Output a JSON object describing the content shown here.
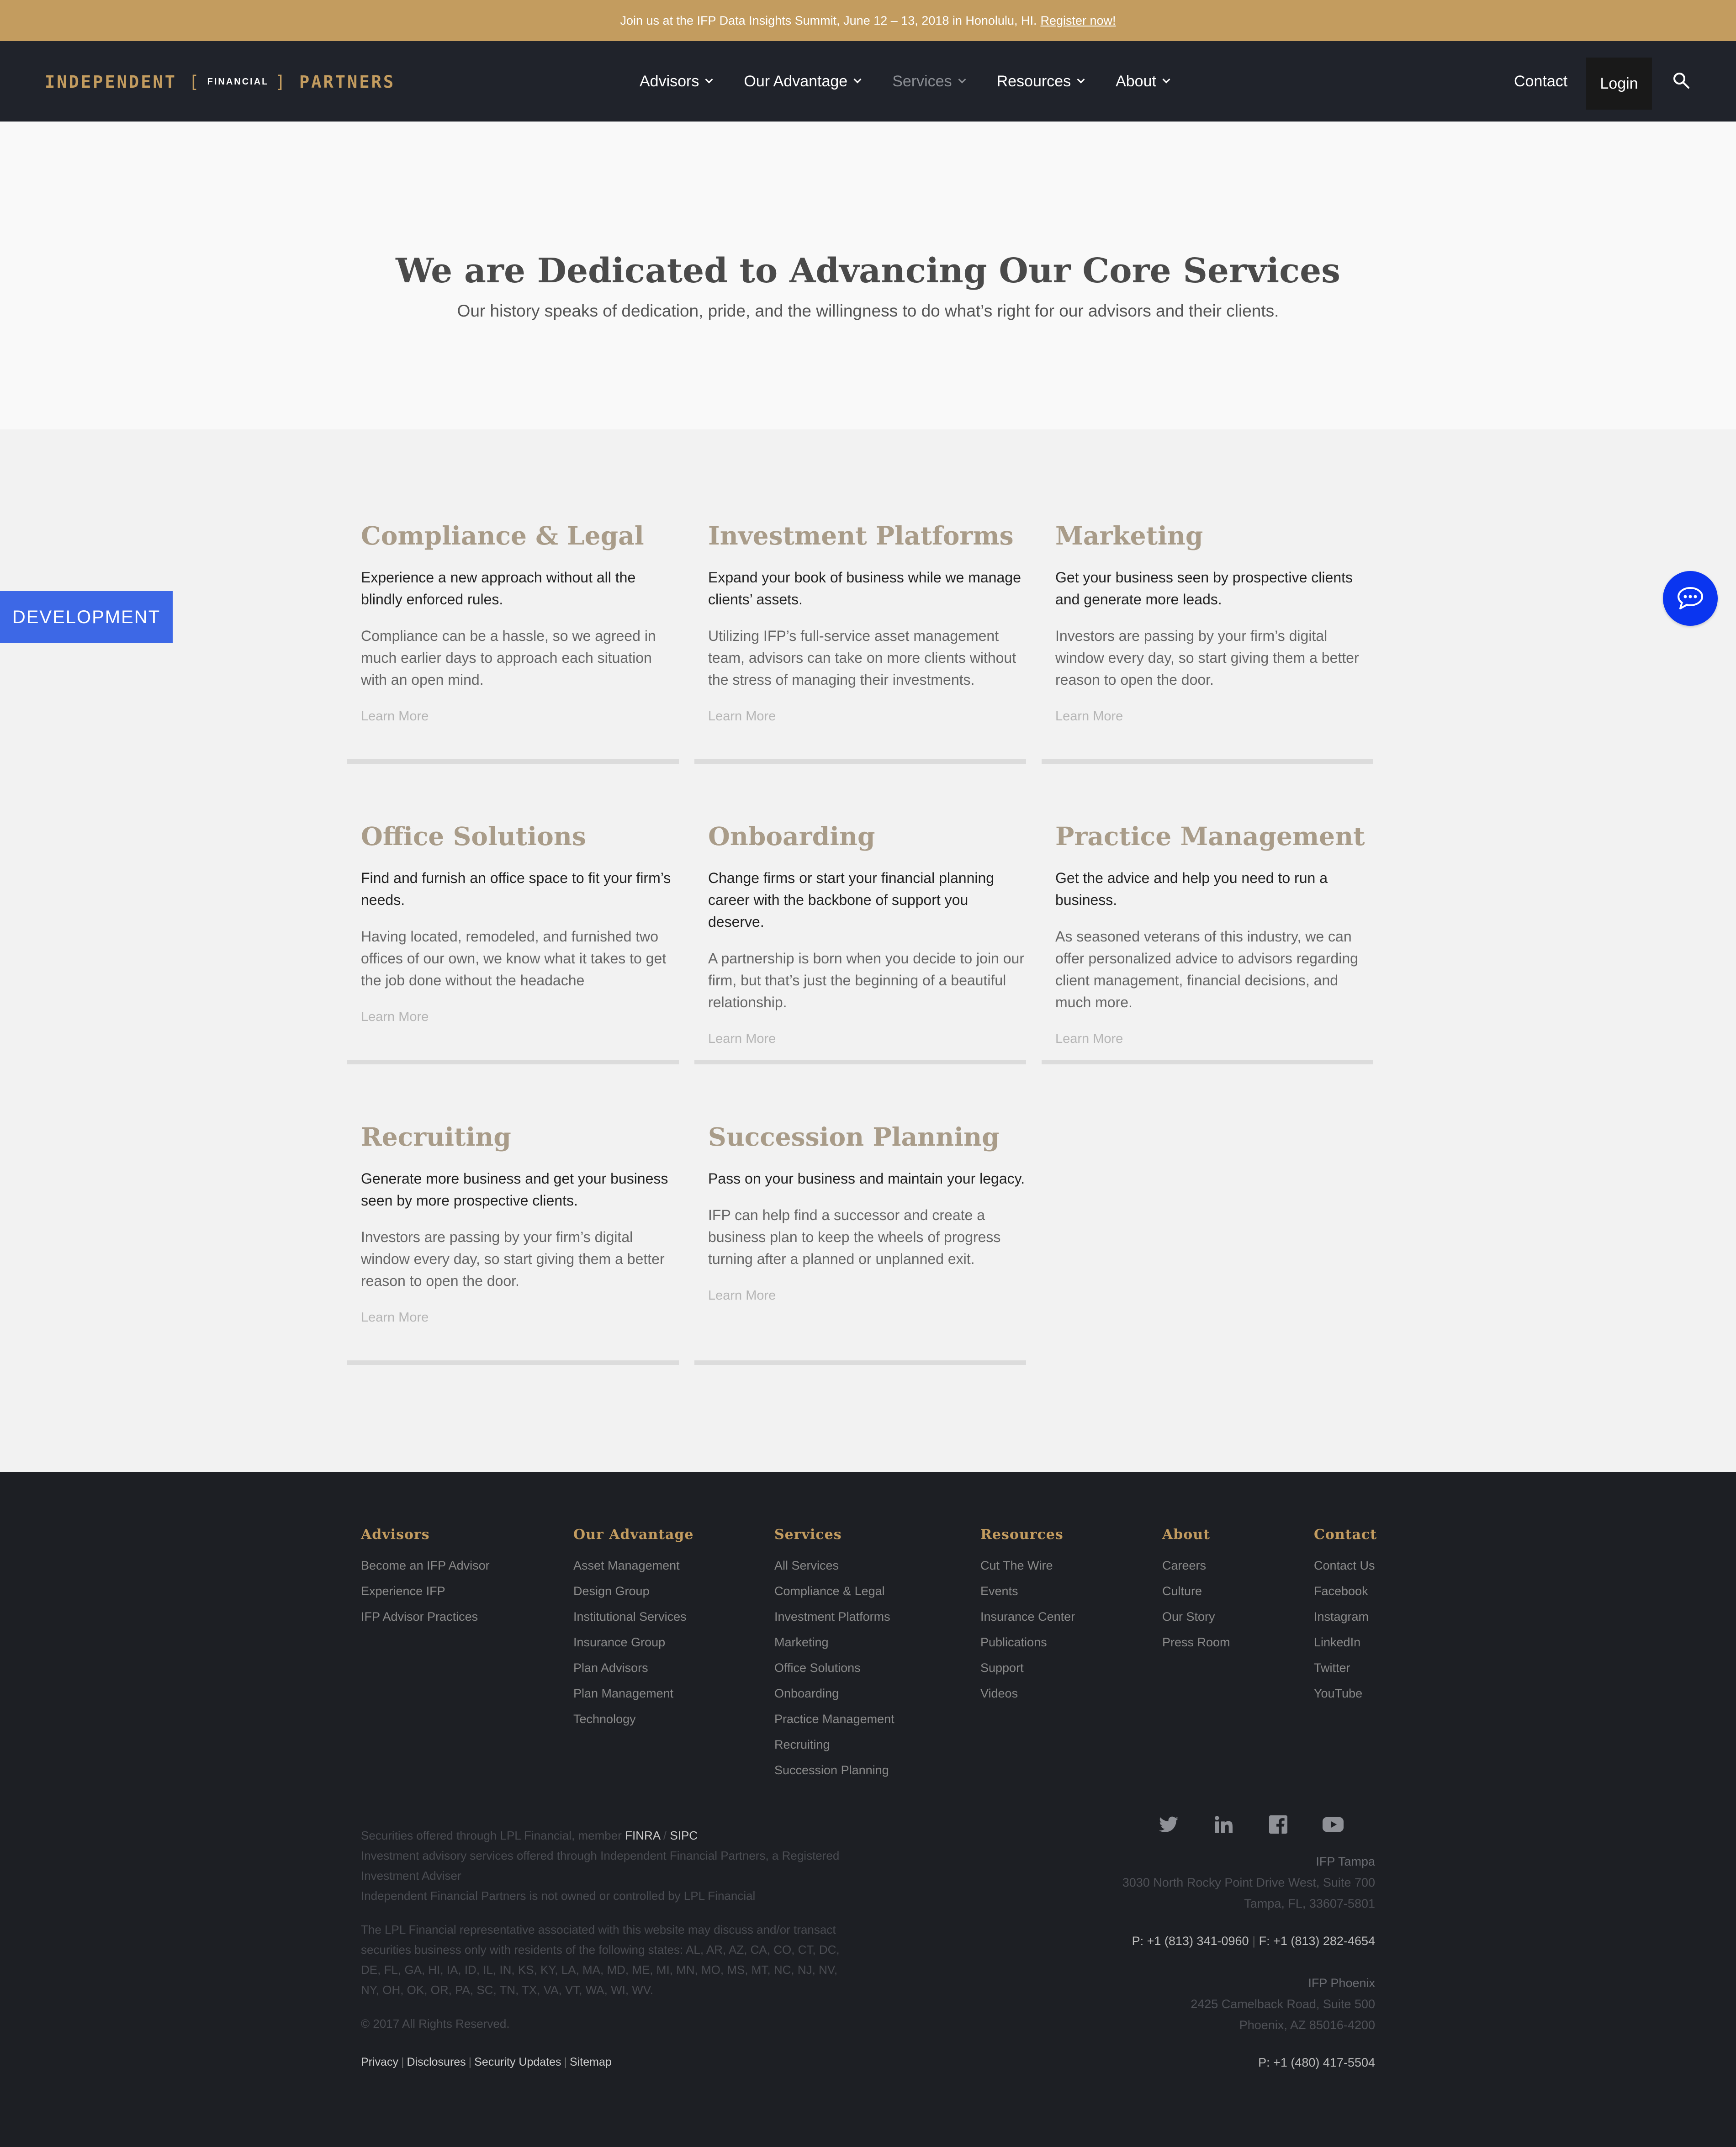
{
  "announcement": {
    "text": "Join us at the IFP Data Insights Summit, June 12 – 13, 2018 in Honolulu, HI.",
    "link": "Register now!"
  },
  "header": {
    "logo": {
      "left": "INDEPENDENT",
      "middle": "FINANCIAL",
      "right": "PARTNERS"
    },
    "nav": [
      "Advisors",
      "Our Advantage",
      "Services",
      "Resources",
      "About"
    ],
    "contact": "Contact",
    "login": "Login"
  },
  "hero": {
    "title": "We are Dedicated to Advancing Our Core Services",
    "subtitle": "Our history speaks of dedication, pride, and the willingness to do what’s right for our advisors and their clients."
  },
  "dev_tab": "DEVELOPMENT",
  "services": [
    {
      "title": "Compliance & Legal",
      "lead": "Experience a new approach without all the blindly enforced rules.",
      "desc": "Compliance can be a hassle, so we agreed in much earlier days to approach each situation with an open mind.",
      "more": "Learn More"
    },
    {
      "title": "Investment Platforms",
      "lead": "Expand your book of business while we manage clients’ assets.",
      "desc": "Utilizing IFP’s full-service asset management team, advisors can take on more clients without the stress of managing their investments.",
      "more": "Learn More"
    },
    {
      "title": "Marketing",
      "lead": "Get your business seen by prospective clients and generate more leads.",
      "desc": "Investors are passing by your firm’s digital window every day, so start giving them a better reason to open the door.",
      "more": "Learn More"
    },
    {
      "title": "Office Solutions",
      "lead": "Find and furnish an office space to fit your firm’s needs.",
      "desc": "Having located, remodeled, and furnished two offices of our own, we know what it takes to get the job done without the headache",
      "more": "Learn More"
    },
    {
      "title": "Onboarding",
      "lead": "Change firms or start your financial planning career with the backbone of support you deserve.",
      "desc": "A partnership is born when you decide to join our firm, but that’s just the beginning of a beautiful relationship.",
      "more": "Learn More"
    },
    {
      "title": "Practice Management",
      "lead": "Get the advice and help you need to run a business.",
      "desc": "As seasoned veterans of this industry, we can offer personalized advice to advisors regarding client management, financial decisions, and much more.",
      "more": "Learn More"
    },
    {
      "title": "Recruiting",
      "lead": "Generate more business and get your business seen by more prospective clients.",
      "desc": "Investors are passing by your firm’s digital window every day, so start giving them a better reason to open the door.",
      "more": "Learn More"
    },
    {
      "title": "Succession Planning",
      "lead": "Pass on your business and maintain your legacy.",
      "desc": "IFP can help find a successor and create a business plan to keep the wheels of progress turning after a planned or unplanned exit.",
      "more": "Learn More"
    }
  ],
  "footer": {
    "columns": [
      {
        "heading": "Advisors",
        "links": [
          "Become an IFP Advisor",
          "Experience IFP",
          "IFP Advisor Practices"
        ]
      },
      {
        "heading": "Our Advantage",
        "links": [
          "Asset Management",
          "Design Group",
          "Institutional Services",
          "Insurance Group",
          "Plan Advisors",
          "Plan Management",
          "Technology"
        ]
      },
      {
        "heading": "Services",
        "links": [
          "All Services",
          "Compliance & Legal",
          "Investment Platforms",
          "Marketing",
          "Office Solutions",
          "Onboarding",
          "Practice Management",
          "Recruiting",
          "Succession Planning"
        ]
      },
      {
        "heading": "Resources",
        "links": [
          "Cut The Wire",
          "Events",
          "Insurance Center",
          "Publications",
          "Support",
          "Videos"
        ]
      },
      {
        "heading": "About",
        "links": [
          "Careers",
          "Culture",
          "Our Story",
          "Press Room"
        ]
      },
      {
        "heading": "Contact",
        "links": [
          "Contact Us",
          "Facebook",
          "Instagram",
          "LinkedIn",
          "Twitter",
          "YouTube"
        ]
      }
    ],
    "legal": {
      "line1_prefix": "Securities offered through LPL Financial, member",
      "finra": "FINRA",
      "slash": "/",
      "sipc": "SIPC",
      "line2": "Investment advisory services offered through Independent Financial Partners, a Registered Investment Adviser",
      "line3": "Independent Financial Partners is not owned or controlled by LPL Financial",
      "states": "The LPL Financial representative associated with this website may discuss and/or transact securities business only with residents of the following states: AL, AR, AZ, CA, CO, CT, DC, DE, FL, GA, HI, IA, ID, IL, IN, KS, KY, LA, MA, MD, ME, MI, MN, MO, MS, MT, NC, NJ, NV, NY, OH, OK, OR, PA, SC, TN, TX, VA, VT, WA, WI, WV.",
      "copyright": "© 2017 All Rights Reserved.",
      "bottom_links": [
        "Privacy",
        "Disclosures",
        "Security Updates",
        "Sitemap"
      ]
    },
    "social_icons": [
      "twitter-icon",
      "linkedin-icon",
      "facebook-icon",
      "youtube-icon"
    ],
    "offices": [
      {
        "name": "IFP Tampa",
        "address1": "3030 North Rocky Point Drive West, Suite 700",
        "address2": "Tampa, FL, 33607-5801",
        "phone_label": "P: +1 (813) 341-0960",
        "fax_label": "F: +1 (813) 282-4654"
      },
      {
        "name": "IFP Phoenix",
        "address1": "2425 Camelback Road, Suite 500",
        "address2": "Phoenix, AZ 85016-4200",
        "phone_label": "P: +1 (480) 417-5504"
      }
    ]
  },
  "colors": {
    "gold": "#c39c5f",
    "header_bg": "#20232b",
    "footer_bg": "#1d1f24",
    "dev_tab": "#3d68e6",
    "chat": "#0a35f0",
    "card_title": "#a99c89"
  }
}
